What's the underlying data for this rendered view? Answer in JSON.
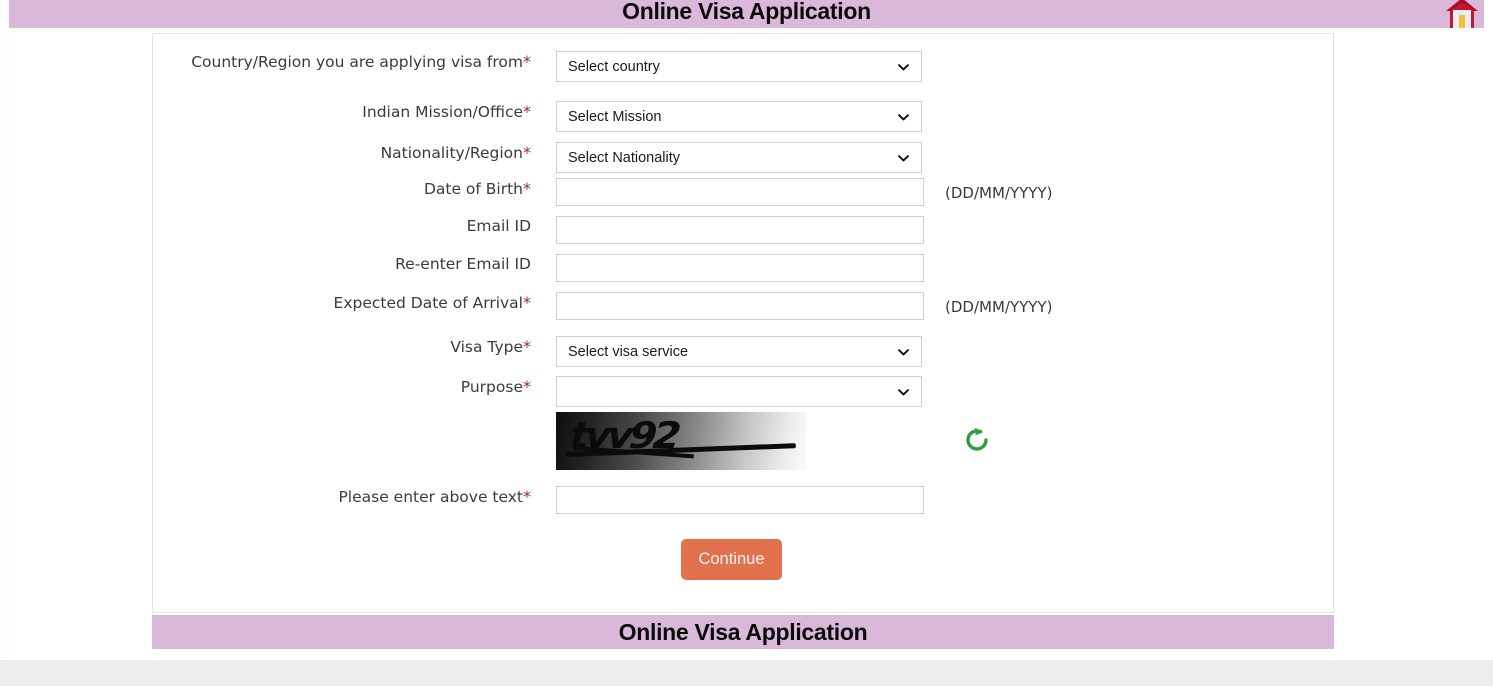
{
  "header": {
    "title": "Online Visa Application",
    "home_icon": "home-icon"
  },
  "footer": {
    "title": "Online Visa Application"
  },
  "form": {
    "fields": [
      {
        "label": "Country/Region you are applying visa from",
        "required": true,
        "control": "select",
        "value": "Select country",
        "hint": ""
      },
      {
        "label": "Indian Mission/Office",
        "required": true,
        "control": "select",
        "value": "Select Mission",
        "hint": ""
      },
      {
        "label": "Nationality/Region",
        "required": true,
        "control": "select",
        "value": "Select Nationality",
        "hint": ""
      },
      {
        "label": "Date of Birth",
        "required": true,
        "control": "text",
        "value": "",
        "placeholder": "",
        "hint": "(DD/MM/YYYY)"
      },
      {
        "label": "Email ID",
        "required": false,
        "control": "text",
        "value": "",
        "placeholder": "",
        "hint": ""
      },
      {
        "label": "Re-enter Email ID",
        "required": false,
        "control": "text",
        "value": "",
        "placeholder": "",
        "hint": ""
      },
      {
        "label": "Expected Date of Arrival",
        "required": true,
        "control": "text",
        "value": "",
        "placeholder": "",
        "hint": "(DD/MM/YYYY)"
      },
      {
        "label": "Visa Type",
        "required": true,
        "control": "select",
        "value": "Select visa service",
        "hint": ""
      },
      {
        "label": "Purpose",
        "required": true,
        "control": "select",
        "value": "",
        "hint": ""
      }
    ],
    "captcha": {
      "text": "tvv92",
      "refresh_icon": "refresh-icon",
      "label": "Please enter above text",
      "required": true,
      "input_value": "",
      "input_placeholder": ""
    },
    "submit": {
      "label": "Continue"
    }
  },
  "colors": {
    "banner": "#d9b8d9",
    "button": "#e2714d",
    "required_asterisk": "#9c2a2a",
    "refresh_green": "#2f9e41",
    "roof_red": "#c0182c"
  }
}
